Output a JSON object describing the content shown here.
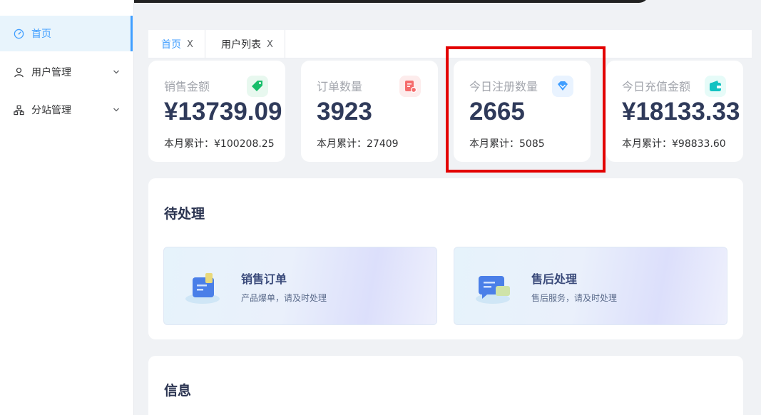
{
  "sidebar": {
    "items": [
      {
        "label": "首页",
        "icon": "dashboard-icon",
        "active": true
      },
      {
        "label": "用户管理",
        "icon": "user-icon",
        "has_children": true
      },
      {
        "label": "分站管理",
        "icon": "sitemap-icon",
        "has_children": true
      }
    ]
  },
  "tabs": [
    {
      "label": "首页",
      "close": "X",
      "active": true
    },
    {
      "label": "用户列表",
      "close": "X",
      "active": false
    }
  ],
  "stats": [
    {
      "label": "销售金额",
      "value": "¥13739.09",
      "sub": "本月累计：¥100208.25",
      "icon": "tag-icon",
      "color": "#19be6b"
    },
    {
      "label": "订单数量",
      "value": "3923",
      "sub": "本月累计：27409",
      "icon": "order-icon",
      "color": "#f56c6c"
    },
    {
      "label": "今日注册数量",
      "value": "2665",
      "sub": "本月累计：5085",
      "icon": "diamond-icon",
      "color": "#409eff"
    },
    {
      "label": "今日充值金额",
      "value": "¥18133.33",
      "sub": "本月累计：¥98833.60",
      "icon": "wallet-icon",
      "color": "#13c2c2"
    }
  ],
  "pending": {
    "title": "待处理",
    "items": [
      {
        "title": "销售订单",
        "desc": "产品爆单，请及时处理",
        "icon": "document-icon"
      },
      {
        "title": "售后处理",
        "desc": "售后服务，请及时处理",
        "icon": "chat-icon"
      }
    ]
  },
  "info": {
    "title": "信息"
  },
  "colors": {
    "accent": "#409eff",
    "highlight": "#e30000",
    "sidebar_active_bg": "#e8f4fc"
  }
}
